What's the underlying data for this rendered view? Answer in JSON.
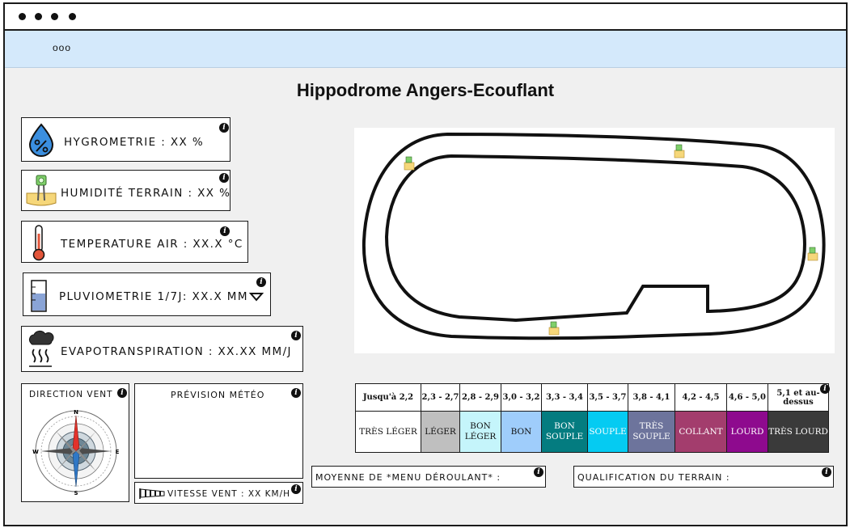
{
  "menu_text": "ooo",
  "title": "Hippodrome Angers-Ecouflant",
  "metrics": {
    "hygrometrie": "HYGROMETRIE : XX %",
    "humidite": "HUMIDITÉ TERRAIN : XX %",
    "temperature": "TEMPERATURE AIR : XX.X °C",
    "pluviometrie": "PLUVIOMETRIE 1/7J: XX.X MM",
    "evapo": "EVAPOTRANSPIRATION : XX.XX MM/J"
  },
  "wind": {
    "direction_label": "DIRECTION VENT",
    "forecast_label": "PRÉVISION MÉTÉO",
    "speed_label": "VITESSE VENT : XX KM/H"
  },
  "compass_letters": {
    "n": "N",
    "s": "S",
    "e": "E",
    "w": "W"
  },
  "grades": [
    {
      "range": "Jusqu'à 2,2",
      "name": "TRÈS LÉGER",
      "color": "#ffffff",
      "text": "#111111"
    },
    {
      "range": "2,3 - 2,7",
      "name": "LÉGER",
      "color": "#bfbfbf",
      "text": "#111111"
    },
    {
      "range": "2,8 - 2,9",
      "name": "BON LÉGER",
      "color": "#c5f5fb",
      "text": "#111111"
    },
    {
      "range": "3,0 - 3,2",
      "name": "BON",
      "color": "#9fcdfb",
      "text": "#111111"
    },
    {
      "range": "3,3 - 3,4",
      "name": "BON SOUPLE",
      "color": "#047c80",
      "text": "#ffffff"
    },
    {
      "range": "3,5 - 3,7",
      "name": "SOUPLE",
      "color": "#05cbf2",
      "text": "#ffffff"
    },
    {
      "range": "3,8 - 4,1",
      "name": "TRÈS SOUPLE",
      "color": "#6d749c",
      "text": "#ffffff"
    },
    {
      "range": "4,2 - 4,5",
      "name": "COLLANT",
      "color": "#a33d6d",
      "text": "#ffffff"
    },
    {
      "range": "4,6 - 5,0",
      "name": "LOURD",
      "color": "#8e0a8e",
      "text": "#ffffff"
    },
    {
      "range": "5,1 et au-dessus",
      "name": "TRÈS LOURD",
      "color": "#3a3a3a",
      "text": "#ffffff"
    }
  ],
  "moyenne": "MOYENNE DE *MENU DÉROULANT* :",
  "qualification": "QUALIFICATION DU TERRAIN :",
  "colors": {
    "header_bg": "#d4e9fb",
    "page_bg": "#f0f0f0"
  }
}
